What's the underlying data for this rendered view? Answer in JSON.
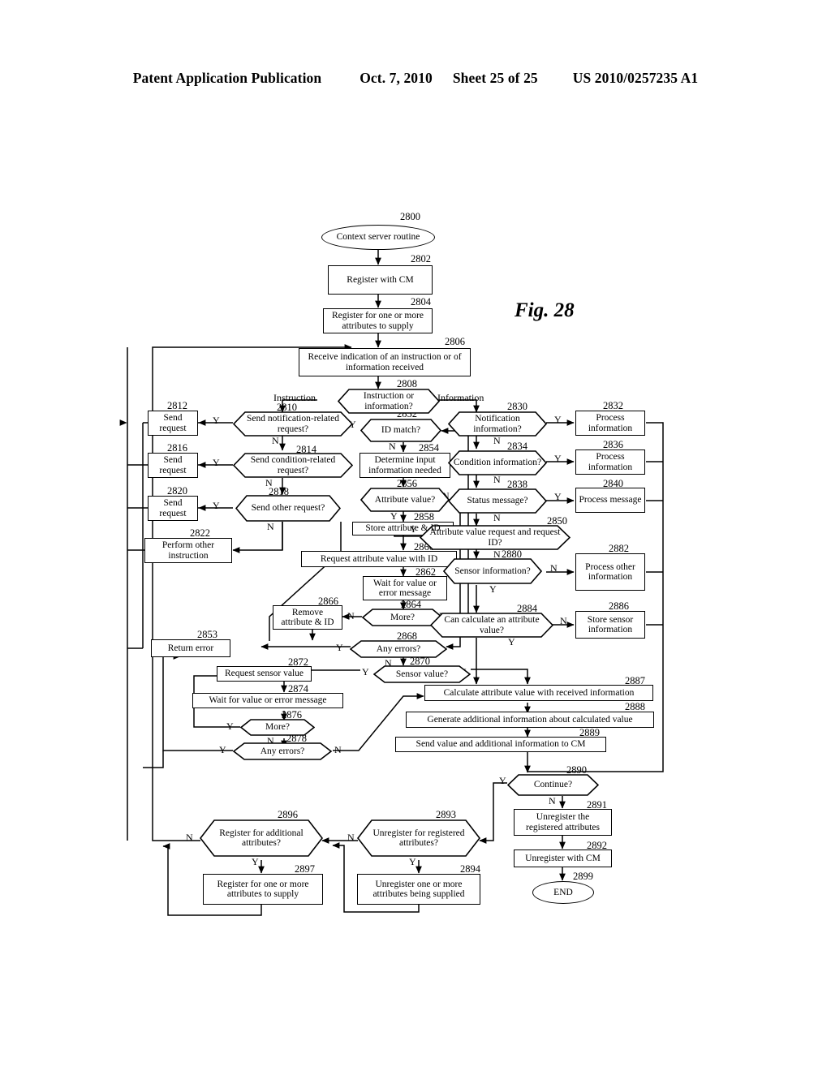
{
  "header": {
    "publication": "Patent Application Publication",
    "date": "Oct. 7, 2010",
    "sheet": "Sheet 25 of 25",
    "number": "US 2010/0257235 A1"
  },
  "figure": {
    "label": "Fig. 28",
    "title": "Context server routine flowchart"
  },
  "nodes": [
    {
      "ref": "2800",
      "shape": "terminator",
      "text": "Context server routine"
    },
    {
      "ref": "2802",
      "shape": "process",
      "text": "Register with CM"
    },
    {
      "ref": "2804",
      "shape": "process",
      "text": "Register for one or more attributes to supply"
    },
    {
      "ref": "2806",
      "shape": "process",
      "text": "Receive indication of an instruction or of information received"
    },
    {
      "ref": "2808",
      "shape": "decision",
      "text": "Instruction or information?"
    },
    {
      "ref": "2810",
      "shape": "decision",
      "text": "Send notification-related request?"
    },
    {
      "ref": "2812",
      "shape": "process",
      "text": "Send request"
    },
    {
      "ref": "2814",
      "shape": "decision",
      "text": "Send condition-related request?"
    },
    {
      "ref": "2816",
      "shape": "process",
      "text": "Send request"
    },
    {
      "ref": "2818",
      "shape": "decision",
      "text": "Send other request?"
    },
    {
      "ref": "2820",
      "shape": "process",
      "text": "Send request"
    },
    {
      "ref": "2822",
      "shape": "process",
      "text": "Perform other instruction"
    },
    {
      "ref": "2852",
      "shape": "decision",
      "text": "ID match?"
    },
    {
      "ref": "2854",
      "shape": "process",
      "text": "Determine input information needed"
    },
    {
      "ref": "2856",
      "shape": "decision",
      "text": "Attribute value?"
    },
    {
      "ref": "2858",
      "shape": "process",
      "text": "Store attribute & ID"
    },
    {
      "ref": "2860",
      "shape": "process",
      "text": "Request attribute value with ID"
    },
    {
      "ref": "2862",
      "shape": "process",
      "text": "Wait for value or error message"
    },
    {
      "ref": "2864",
      "shape": "decision",
      "text": "More?"
    },
    {
      "ref": "2866",
      "shape": "process",
      "text": "Remove attribute & ID"
    },
    {
      "ref": "2868",
      "shape": "decision",
      "text": "Any errors?"
    },
    {
      "ref": "2870",
      "shape": "decision",
      "text": "Sensor value?"
    },
    {
      "ref": "2853",
      "shape": "process",
      "text": "Return error"
    },
    {
      "ref": "2872",
      "shape": "process",
      "text": "Request sensor value"
    },
    {
      "ref": "2874",
      "shape": "process",
      "text": "Wait for value or error message"
    },
    {
      "ref": "2876",
      "shape": "decision",
      "text": "More?"
    },
    {
      "ref": "2878",
      "shape": "decision",
      "text": "Any errors?"
    },
    {
      "ref": "2830",
      "shape": "decision",
      "text": "Notification information?"
    },
    {
      "ref": "2832",
      "shape": "process",
      "text": "Process information"
    },
    {
      "ref": "2834",
      "shape": "decision",
      "text": "Condition information?"
    },
    {
      "ref": "2836",
      "shape": "process",
      "text": "Process information"
    },
    {
      "ref": "2838",
      "shape": "decision",
      "text": "Status message?"
    },
    {
      "ref": "2840",
      "shape": "process",
      "text": "Process message"
    },
    {
      "ref": "2850",
      "shape": "decision",
      "text": "Attribute value request and request ID?"
    },
    {
      "ref": "2880",
      "shape": "decision",
      "text": "Sensor information?"
    },
    {
      "ref": "2882",
      "shape": "process",
      "text": "Process other information"
    },
    {
      "ref": "2884",
      "shape": "decision",
      "text": "Can calculate an attribute value?"
    },
    {
      "ref": "2886",
      "shape": "process",
      "text": "Store sensor information"
    },
    {
      "ref": "2887",
      "shape": "process",
      "text": "Calculate attribute value with received information"
    },
    {
      "ref": "2888",
      "shape": "process",
      "text": "Generate additional information about calculated value"
    },
    {
      "ref": "2889",
      "shape": "process",
      "text": "Send value and additional information to CM"
    },
    {
      "ref": "2890",
      "shape": "decision",
      "text": "Continue?"
    },
    {
      "ref": "2891",
      "shape": "process",
      "text": "Unregister the registered attributes"
    },
    {
      "ref": "2892",
      "shape": "process",
      "text": "Unregister with CM"
    },
    {
      "ref": "2899",
      "shape": "terminator",
      "text": "END"
    },
    {
      "ref": "2893",
      "shape": "decision",
      "text": "Unregister for registered attributes?"
    },
    {
      "ref": "2894",
      "shape": "process",
      "text": "Unregister one or more attributes being supplied"
    },
    {
      "ref": "2896",
      "shape": "decision",
      "text": "Register for additional attributes?"
    },
    {
      "ref": "2897",
      "shape": "process",
      "text": "Register for one or more attributes to supply"
    }
  ],
  "branch_labels": {
    "instruction": "Instruction",
    "information": "Information",
    "yes": "Y",
    "no": "N"
  },
  "edges": [
    {
      "from": "2800",
      "to": "2802",
      "label": ""
    },
    {
      "from": "2802",
      "to": "2804",
      "label": ""
    },
    {
      "from": "2804",
      "to": "2806",
      "label": ""
    },
    {
      "from": "2806",
      "to": "2808",
      "label": ""
    },
    {
      "from": "2808",
      "to": "2810",
      "label": "Instruction"
    },
    {
      "from": "2808",
      "to": "2830",
      "label": "Information"
    },
    {
      "from": "2810",
      "to": "2812",
      "label": "Y"
    },
    {
      "from": "2810",
      "to": "2814",
      "label": "N"
    },
    {
      "from": "2814",
      "to": "2816",
      "label": "Y"
    },
    {
      "from": "2814",
      "to": "2818",
      "label": "N"
    },
    {
      "from": "2818",
      "to": "2820",
      "label": "Y"
    },
    {
      "from": "2818",
      "to": "2822",
      "label": "N"
    },
    {
      "from": "2852",
      "to": "2854",
      "label": "N"
    },
    {
      "from": "2852",
      "to": "2853",
      "label": "Y"
    },
    {
      "from": "2854",
      "to": "2856",
      "label": ""
    },
    {
      "from": "2856",
      "to": "2858",
      "label": "Y"
    },
    {
      "from": "2856",
      "to": "2868",
      "label": "N"
    },
    {
      "from": "2858",
      "to": "2860",
      "label": ""
    },
    {
      "from": "2860",
      "to": "2862",
      "label": ""
    },
    {
      "from": "2862",
      "to": "2864",
      "label": ""
    },
    {
      "from": "2864",
      "to": "2866",
      "label": "N"
    },
    {
      "from": "2864",
      "to": "2852",
      "label": "Y"
    },
    {
      "from": "2866",
      "to": "2868",
      "label": ""
    },
    {
      "from": "2868",
      "to": "2853",
      "label": "Y"
    },
    {
      "from": "2868",
      "to": "2870",
      "label": "N"
    },
    {
      "from": "2870",
      "to": "2872",
      "label": "Y"
    },
    {
      "from": "2870",
      "to": "2887",
      "label": "N"
    },
    {
      "from": "2872",
      "to": "2874",
      "label": ""
    },
    {
      "from": "2874",
      "to": "2876",
      "label": ""
    },
    {
      "from": "2876",
      "to": "2872",
      "label": "Y"
    },
    {
      "from": "2876",
      "to": "2878",
      "label": "N"
    },
    {
      "from": "2878",
      "to": "2853",
      "label": "Y"
    },
    {
      "from": "2878",
      "to": "2887",
      "label": "N"
    },
    {
      "from": "2830",
      "to": "2832",
      "label": "Y"
    },
    {
      "from": "2830",
      "to": "2834",
      "label": "N"
    },
    {
      "from": "2834",
      "to": "2836",
      "label": "Y"
    },
    {
      "from": "2834",
      "to": "2838",
      "label": "N"
    },
    {
      "from": "2838",
      "to": "2840",
      "label": "Y"
    },
    {
      "from": "2838",
      "to": "2850",
      "label": "N"
    },
    {
      "from": "2850",
      "to": "2852",
      "label": "Y"
    },
    {
      "from": "2850",
      "to": "2880",
      "label": "N"
    },
    {
      "from": "2880",
      "to": "2882",
      "label": "N"
    },
    {
      "from": "2880",
      "to": "2884",
      "label": "Y"
    },
    {
      "from": "2884",
      "to": "2886",
      "label": "N"
    },
    {
      "from": "2884",
      "to": "2887",
      "label": "Y"
    },
    {
      "from": "2887",
      "to": "2888",
      "label": ""
    },
    {
      "from": "2888",
      "to": "2889",
      "label": ""
    },
    {
      "from": "2889",
      "to": "2890",
      "label": ""
    },
    {
      "from": "2890",
      "to": "2893",
      "label": "Y"
    },
    {
      "from": "2890",
      "to": "2891",
      "label": "N"
    },
    {
      "from": "2891",
      "to": "2892",
      "label": ""
    },
    {
      "from": "2892",
      "to": "2899",
      "label": ""
    },
    {
      "from": "2893",
      "to": "2894",
      "label": "Y"
    },
    {
      "from": "2893",
      "to": "2896",
      "label": "N"
    },
    {
      "from": "2894",
      "to": "2896",
      "label": ""
    },
    {
      "from": "2896",
      "to": "2897",
      "label": "Y"
    },
    {
      "from": "2896",
      "to": "2806",
      "label": "N"
    },
    {
      "from": "2897",
      "to": "2806",
      "label": ""
    }
  ]
}
